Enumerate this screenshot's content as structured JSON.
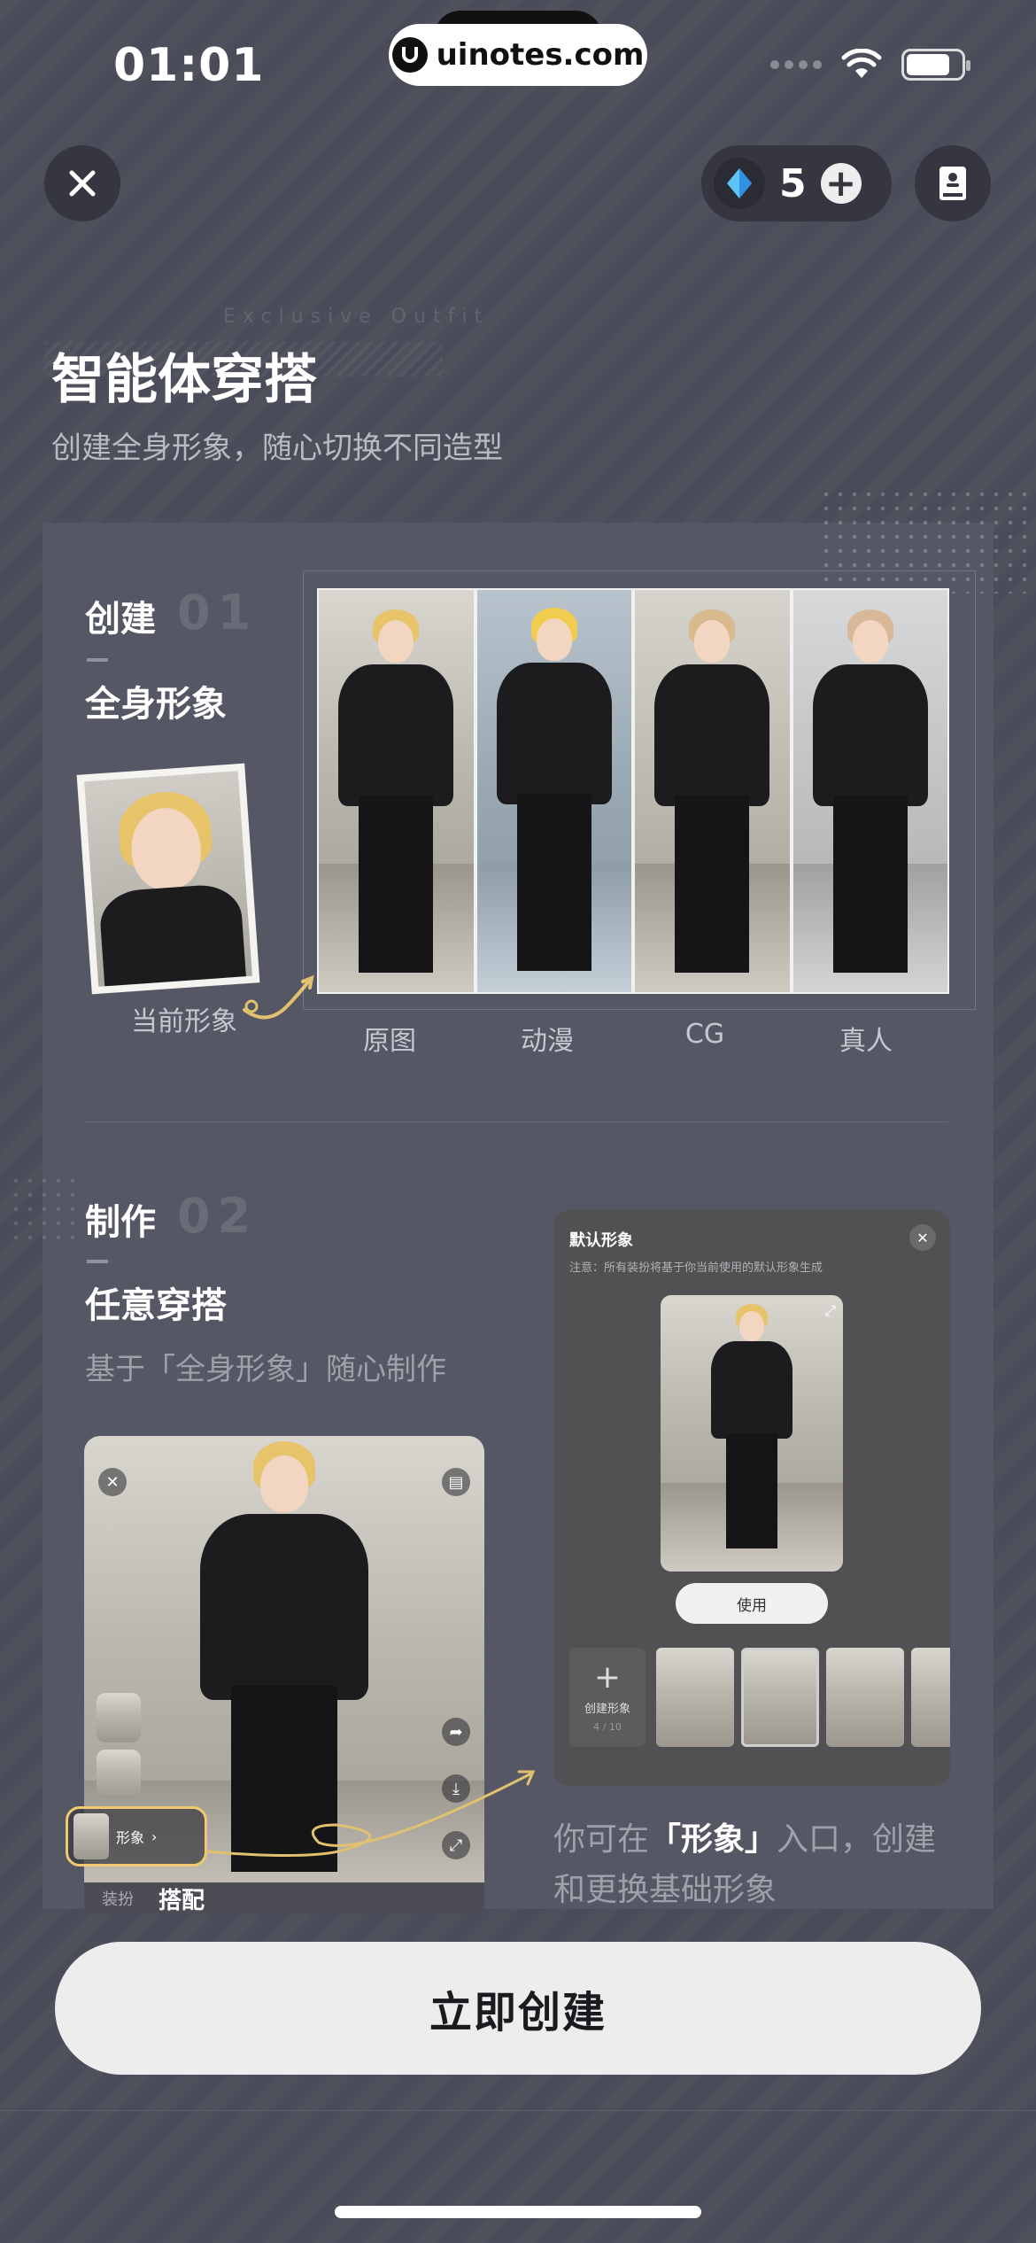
{
  "status_bar": {
    "time": "01:01",
    "watermark": "uinotes.com"
  },
  "header": {
    "gem_count": "5",
    "plus": "+",
    "deco_text": "Exclusive Outfit",
    "title": "智能体穿搭",
    "subtitle": "创建全身形象，随心切换不同造型"
  },
  "section1": {
    "title": "创建",
    "number": "01",
    "heading": "全身形象",
    "current_label": "当前形象",
    "styles": [
      "原图",
      "动漫",
      "CG",
      "真人"
    ]
  },
  "section2": {
    "title": "制作",
    "number": "02",
    "heading": "任意穿搭",
    "description": "基于「全身形象」随心制作",
    "phone": {
      "chip_label": "形象",
      "bar_label_a": "装扮",
      "bar_label_b": "搭配"
    },
    "dialog": {
      "title": "默认形象",
      "note": "注意：所有装扮将基于你当前使用的默认形象生成",
      "use_button": "使用",
      "create_label": "创建形象",
      "create_count": "4 / 10"
    },
    "desc_pre": "你可在",
    "desc_bold": "「形象」",
    "desc_post": "入口，创建和更换基础形象"
  },
  "cta": {
    "label": "立即创建"
  },
  "colors": {
    "background": "#4a4c59",
    "card": "#555765",
    "accent_gold": "#f1c970",
    "cta_bg": "#ededee"
  }
}
